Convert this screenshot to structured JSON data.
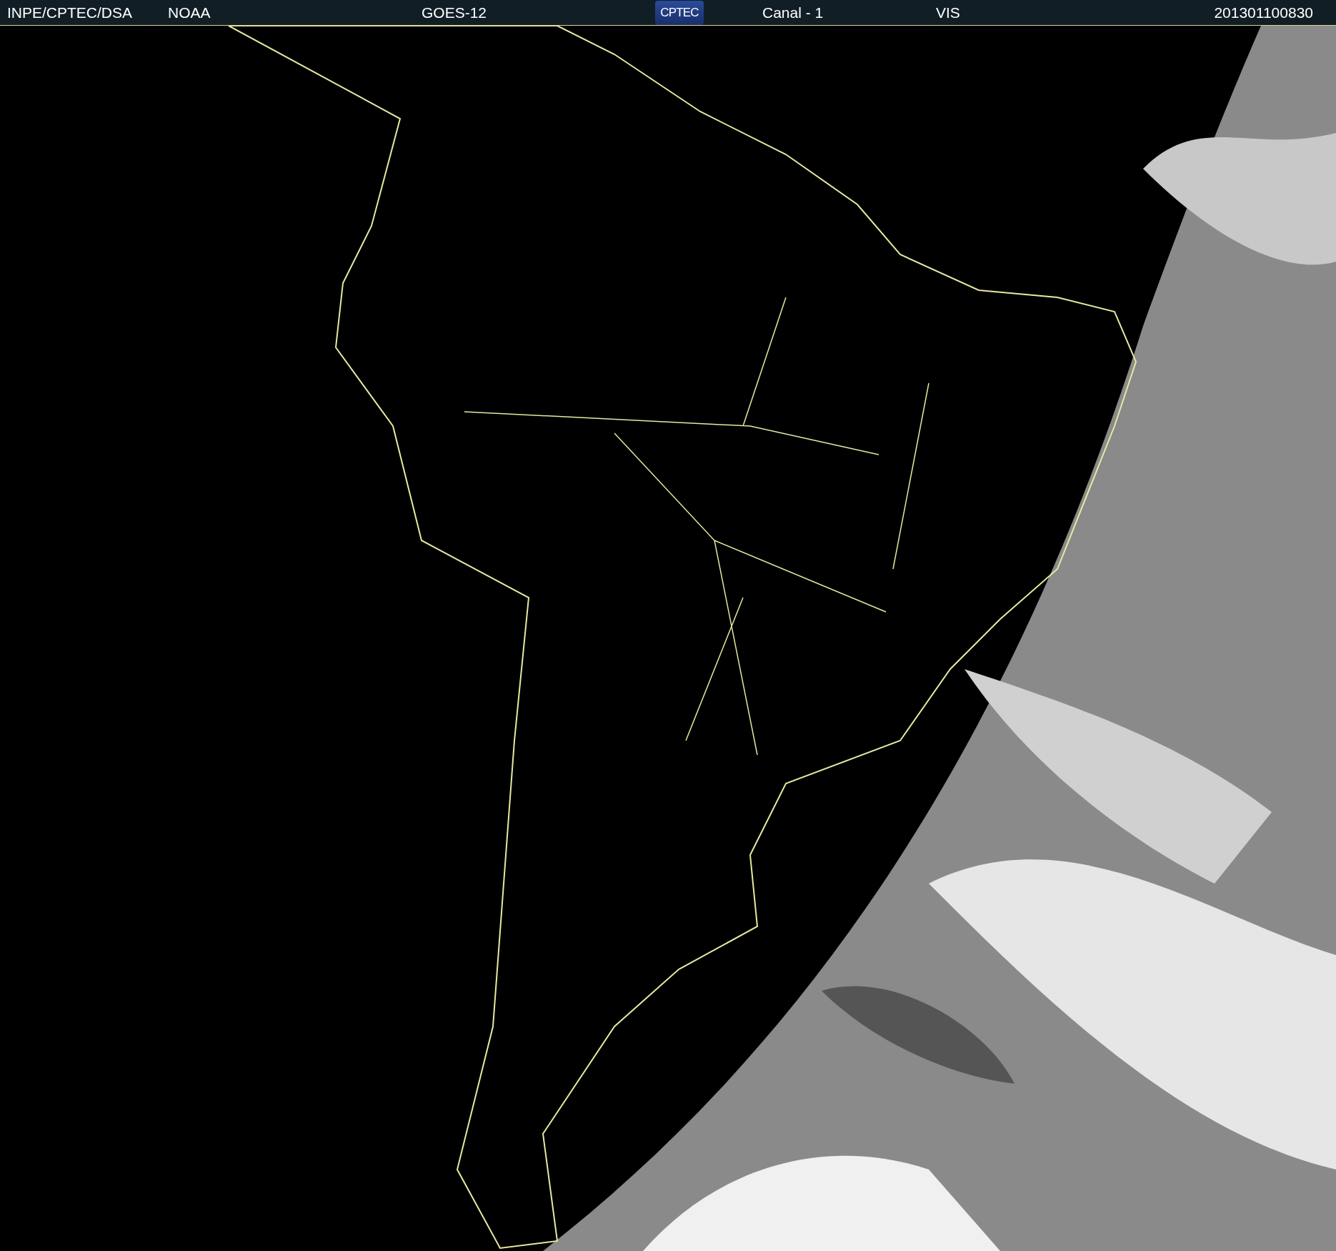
{
  "header": {
    "labels": [
      "INPE/CPTEC/DSA",
      "NOAA",
      "GOES-12"
    ],
    "logo": "CPTEC",
    "channel": [
      "Canal - 1",
      "VIS"
    ],
    "timestamp": "201301100830"
  }
}
